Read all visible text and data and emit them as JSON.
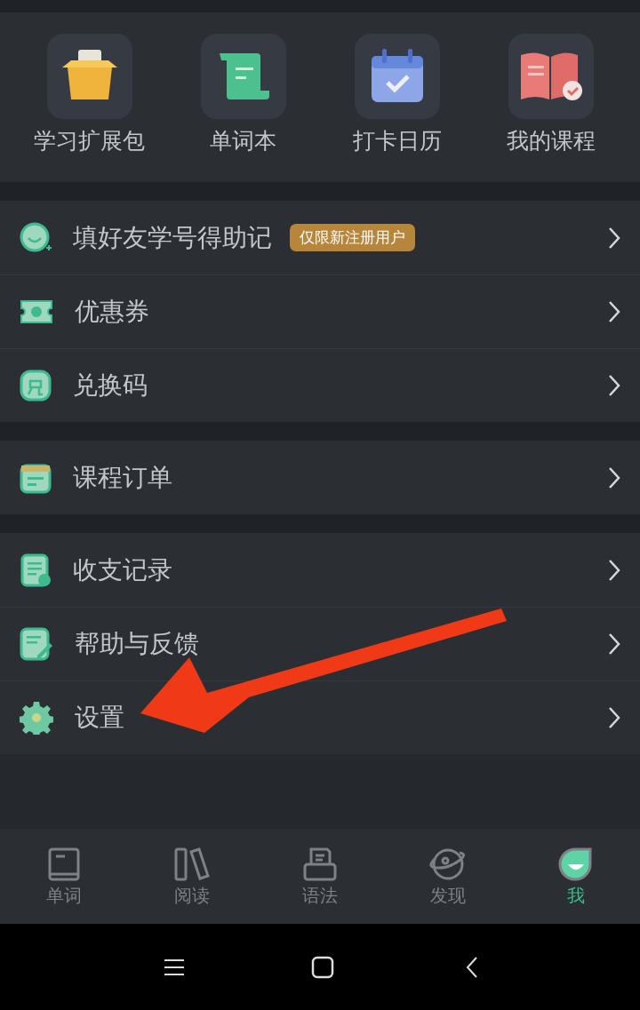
{
  "shortcuts": [
    {
      "label": "学习扩展包"
    },
    {
      "label": "单词本"
    },
    {
      "label": "打卡日历"
    },
    {
      "label": "我的课程"
    }
  ],
  "menu_groups": [
    {
      "items": [
        {
          "label": "填好友学号得助记",
          "badge": "仅限新注册用户"
        },
        {
          "label": "优惠券"
        },
        {
          "label": "兑换码"
        }
      ]
    },
    {
      "items": [
        {
          "label": "课程订单"
        }
      ]
    },
    {
      "items": [
        {
          "label": "收支记录"
        },
        {
          "label": "帮助与反馈"
        },
        {
          "label": "设置"
        }
      ]
    }
  ],
  "tab_bar": [
    {
      "label": "单词",
      "selected": false
    },
    {
      "label": "阅读",
      "selected": false
    },
    {
      "label": "语法",
      "selected": false
    },
    {
      "label": "发现",
      "selected": false
    },
    {
      "label": "我",
      "selected": true
    }
  ]
}
